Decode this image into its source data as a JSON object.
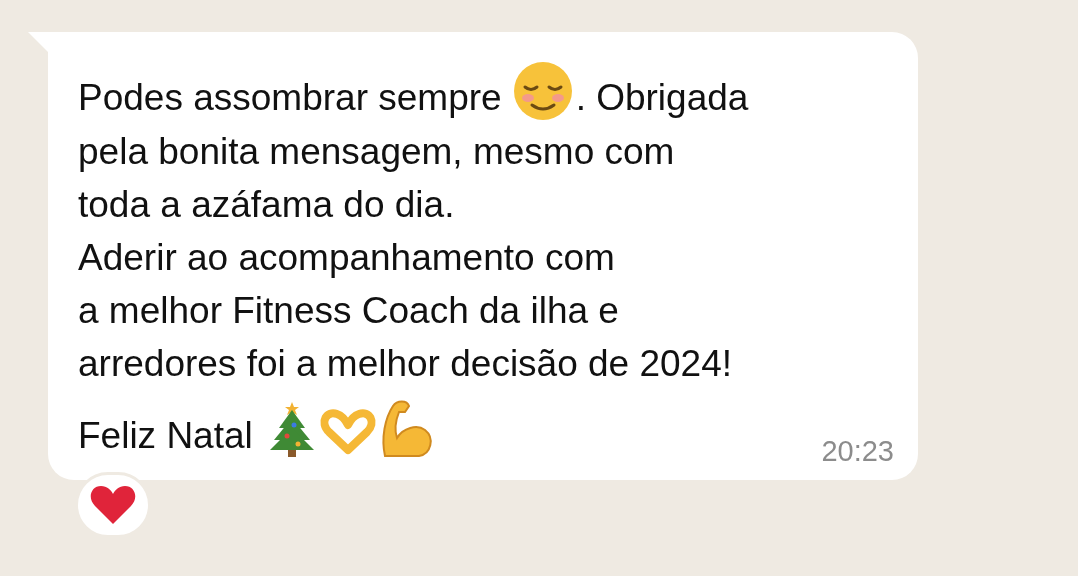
{
  "message": {
    "lines": [
      [
        {
          "kind": "text",
          "text": "Podes assombrar sempre"
        },
        {
          "kind": "relieved"
        },
        {
          "kind": "text",
          "text": ". Obrigada"
        }
      ],
      [
        {
          "kind": "text",
          "text": "pela bonita mensagem, mesmo com"
        }
      ],
      [
        {
          "kind": "text",
          "text": "toda a azáfama do dia."
        }
      ],
      [
        {
          "kind": "text",
          "text": "Aderir ao acompanhamento com"
        }
      ],
      [
        {
          "kind": "text",
          "text": "a melhor Fitness Coach da ilha e"
        }
      ],
      [
        {
          "kind": "text",
          "text": "arredores foi a melhor decisão de 2024!"
        }
      ],
      [
        {
          "kind": "text",
          "text": "Feliz Natal"
        },
        {
          "kind": "tree"
        },
        {
          "kind": "hearthands"
        },
        {
          "kind": "flex"
        }
      ]
    ],
    "time": "20:23",
    "reaction": {
      "kind": "heart"
    }
  }
}
